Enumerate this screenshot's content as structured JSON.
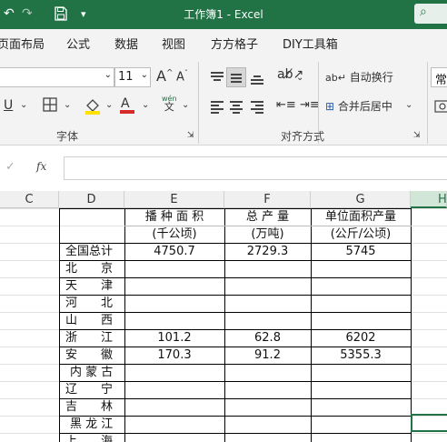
{
  "titlebar": {
    "title": "工作簿1  -  Excel",
    "qa_icons": [
      "redo-icon",
      "save-icon",
      "customize-dropdown-icon"
    ]
  },
  "menu": {
    "tabs": [
      "页面布局",
      "公式",
      "数据",
      "视图",
      "方方格子",
      "DIY工具箱"
    ]
  },
  "ribbon": {
    "font_size": "11",
    "grow_font": "A",
    "shrink_font": "A",
    "underline": "U",
    "phonetic_top": "wén",
    "phonetic_bottom": "文",
    "font_group_label": "字体",
    "wrap_text_label": "自动换行",
    "merge_center_label": "合并后居中",
    "align_group_label": "对齐方式",
    "general_format_label": "常"
  },
  "formula_bar": {
    "cancel_symbol": "✓",
    "fx_label": "fx",
    "value": ""
  },
  "columns": [
    {
      "id": "C",
      "label": "C"
    },
    {
      "id": "D",
      "label": "D"
    },
    {
      "id": "E",
      "label": "E"
    },
    {
      "id": "F",
      "label": "F"
    },
    {
      "id": "G",
      "label": "G"
    },
    {
      "id": "H",
      "label": "H"
    }
  ],
  "sheet": {
    "header1": {
      "E": "播 种 面 积",
      "F": "总    产    量",
      "G": "单位面积产量"
    },
    "header2": {
      "E": "(千公顷)",
      "F": "(万吨)",
      "G": "(公斤/公顷)"
    },
    "rows": [
      {
        "region": "全国总计",
        "E": "4750.7",
        "F": "2729.3",
        "G": "5745"
      },
      {
        "region": "北　　京",
        "E": "",
        "F": "",
        "G": ""
      },
      {
        "region": "天　　津",
        "E": "",
        "F": "",
        "G": ""
      },
      {
        "region": "河　　北",
        "E": "",
        "F": "",
        "G": ""
      },
      {
        "region": "山　　西",
        "E": "",
        "F": "",
        "G": ""
      },
      {
        "region": "浙　　江",
        "E": "101.2",
        "F": "62.8",
        "G": "6202"
      },
      {
        "region": "安　　徽",
        "E": "170.3",
        "F": "91.2",
        "G": "5355.3"
      },
      {
        "region": "内 蒙 古",
        "E": "",
        "F": "",
        "G": ""
      },
      {
        "region": "辽　　宁",
        "E": "",
        "F": "",
        "G": ""
      },
      {
        "region": "吉　　林",
        "E": "",
        "F": "",
        "G": ""
      },
      {
        "region": "黑 龙 江",
        "E": "",
        "F": "",
        "G": ""
      },
      {
        "region": "上　　海",
        "E": "",
        "F": "",
        "G": ""
      }
    ]
  },
  "colors": {
    "brand": "#217346",
    "ribbon_bg": "#f3f3f3"
  }
}
